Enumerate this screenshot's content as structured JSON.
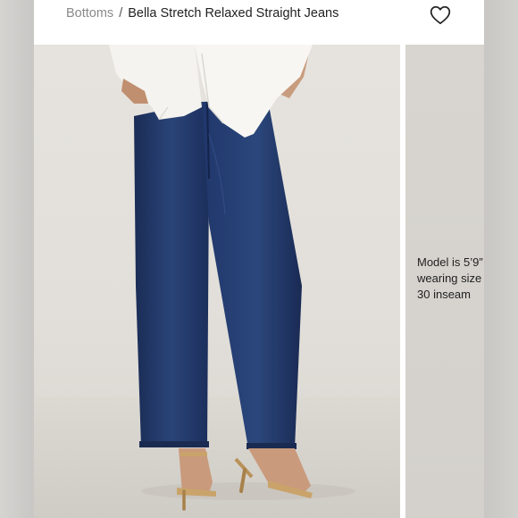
{
  "breadcrumb": {
    "parent": "Bottoms",
    "separator": "/",
    "current": "Bella Stretch Relaxed Straight Jeans"
  },
  "icons": {
    "favorite": "heart-outline-icon"
  },
  "model_info": {
    "line1": "Model is 5’9”",
    "line2": "wearing size",
    "line3": "30 inseam"
  },
  "colors": {
    "denim": "#1f3566",
    "background": "#e4e1dc"
  }
}
